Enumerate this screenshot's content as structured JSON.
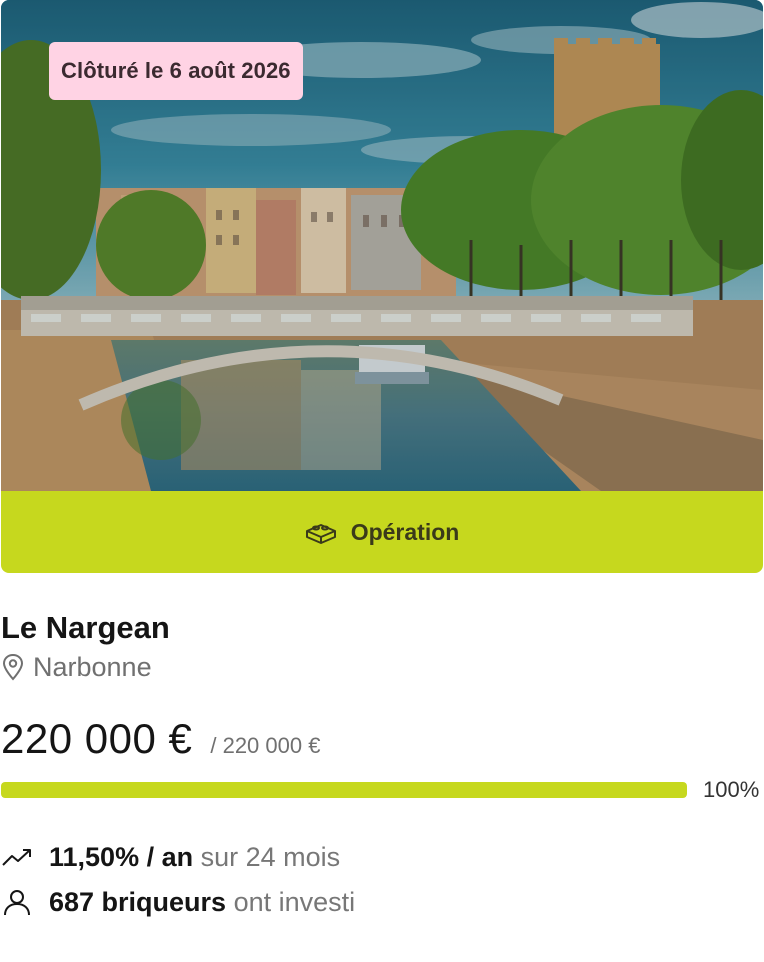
{
  "hero": {
    "badge_label": "Clôturé le 6 août 2026",
    "share_icon": "share-icon"
  },
  "operation": {
    "label": "Opération",
    "icon": "brick-icon"
  },
  "project": {
    "title": "Le Nargean",
    "location": "Narbonne",
    "location_icon": "map-pin-icon"
  },
  "funding": {
    "raised": "220 000 €",
    "target": "/ 220 000 €",
    "progress_percent": 100,
    "progress_label": "100%"
  },
  "stats": {
    "rate_strong": "11,50% / an",
    "rate_rest": "sur 24 mois",
    "rate_icon": "trending-up-icon",
    "investors_strong": "687 briqueurs",
    "investors_rest": "ont investi",
    "investors_icon": "user-icon"
  },
  "colors": {
    "accent": "#c6d81e",
    "badge_bg": "#ffd3e4",
    "muted_text": "#707070"
  }
}
